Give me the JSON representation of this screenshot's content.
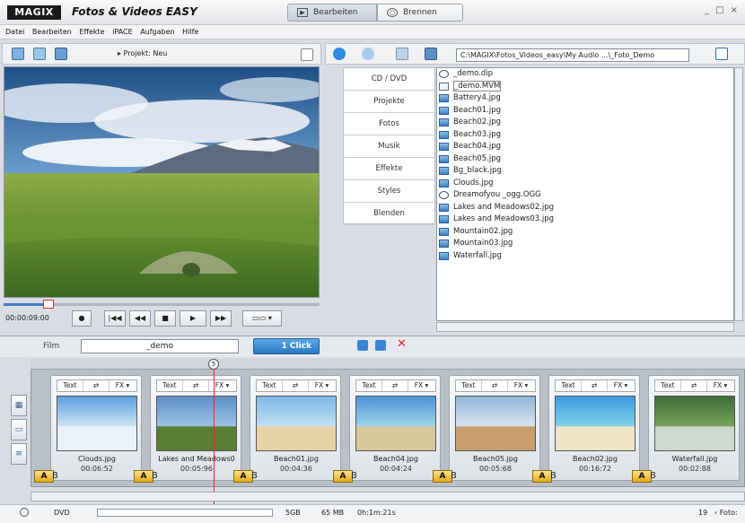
{
  "app": {
    "logo": "MAGIX",
    "title": "Fotos & Videos EASY",
    "window_controls": "_ □ ×"
  },
  "modes": [
    {
      "label": "Bearbeiten",
      "active": true
    },
    {
      "label": "Brennen",
      "active": false
    }
  ],
  "menu": [
    "Datei",
    "Bearbeiten",
    "Effekte",
    "iPACE",
    "Aufgaben",
    "Hilfe"
  ],
  "preview": {
    "project_label": "▸ Projekt: Neu",
    "timecode": "00:00:09:00"
  },
  "transport": {
    "record": "●",
    "to_start": "|◀◀",
    "rewind": "◀◀",
    "stop": "■",
    "play": "▶",
    "forward": "▶▶"
  },
  "browser": {
    "path": "C:\\MAGIX\\Fotos_Videos_easy\\My Audio ...\\_Foto_Demo",
    "categories": [
      "CD / DVD",
      "Projekte",
      "Fotos",
      "Musik",
      "Effekte",
      "Styles",
      "Blenden"
    ],
    "files": [
      {
        "name": "_demo.dip",
        "type": "media"
      },
      {
        "name": "_demo.MVM",
        "type": "mvm"
      },
      {
        "name": "Battery4.jpg",
        "type": "image"
      },
      {
        "name": "Beach01.jpg",
        "type": "image"
      },
      {
        "name": "Beach02.jpg",
        "type": "image"
      },
      {
        "name": "Beach03.jpg",
        "type": "image"
      },
      {
        "name": "Beach04.jpg",
        "type": "image"
      },
      {
        "name": "Beach05.jpg",
        "type": "image"
      },
      {
        "name": "Bg_black.jpg",
        "type": "image"
      },
      {
        "name": "Clouds.jpg",
        "type": "image"
      },
      {
        "name": "Dreamofyou _ogg.OGG",
        "type": "media"
      },
      {
        "name": "Lakes and Meadows02.jpg",
        "type": "image"
      },
      {
        "name": "Lakes and Meadows03.jpg",
        "type": "image"
      },
      {
        "name": "Mountain02.jpg",
        "type": "image"
      },
      {
        "name": "Mountain03.jpg",
        "type": "image"
      },
      {
        "name": "Waterfall.jpg",
        "type": "image"
      }
    ]
  },
  "film": {
    "label": "Film",
    "name": "_demo",
    "one_click": "1 Click"
  },
  "playhead_marker": "5",
  "clip_toolbar": {
    "text": "Text",
    "fx": "FX ▾"
  },
  "clips": [
    {
      "name": "Clouds.jpg",
      "duration": "00:06:52"
    },
    {
      "name": "Lakes and Meadows0",
      "duration": "00:05:96"
    },
    {
      "name": "Beach01.jpg",
      "duration": "00:04:36"
    },
    {
      "name": "Beach04.jpg",
      "duration": "00:04:24"
    },
    {
      "name": "Beach05.jpg",
      "duration": "00:05:68"
    },
    {
      "name": "Beach02.jpg",
      "duration": "00:16:72"
    },
    {
      "name": "Waterfall.jpg",
      "duration": "00:02:88"
    }
  ],
  "status": {
    "medium": "DVD",
    "cap": "5GB",
    "used": "65 MB",
    "duration": "0h:1m:21s",
    "count": "19",
    "next": "‹ Foto:"
  }
}
